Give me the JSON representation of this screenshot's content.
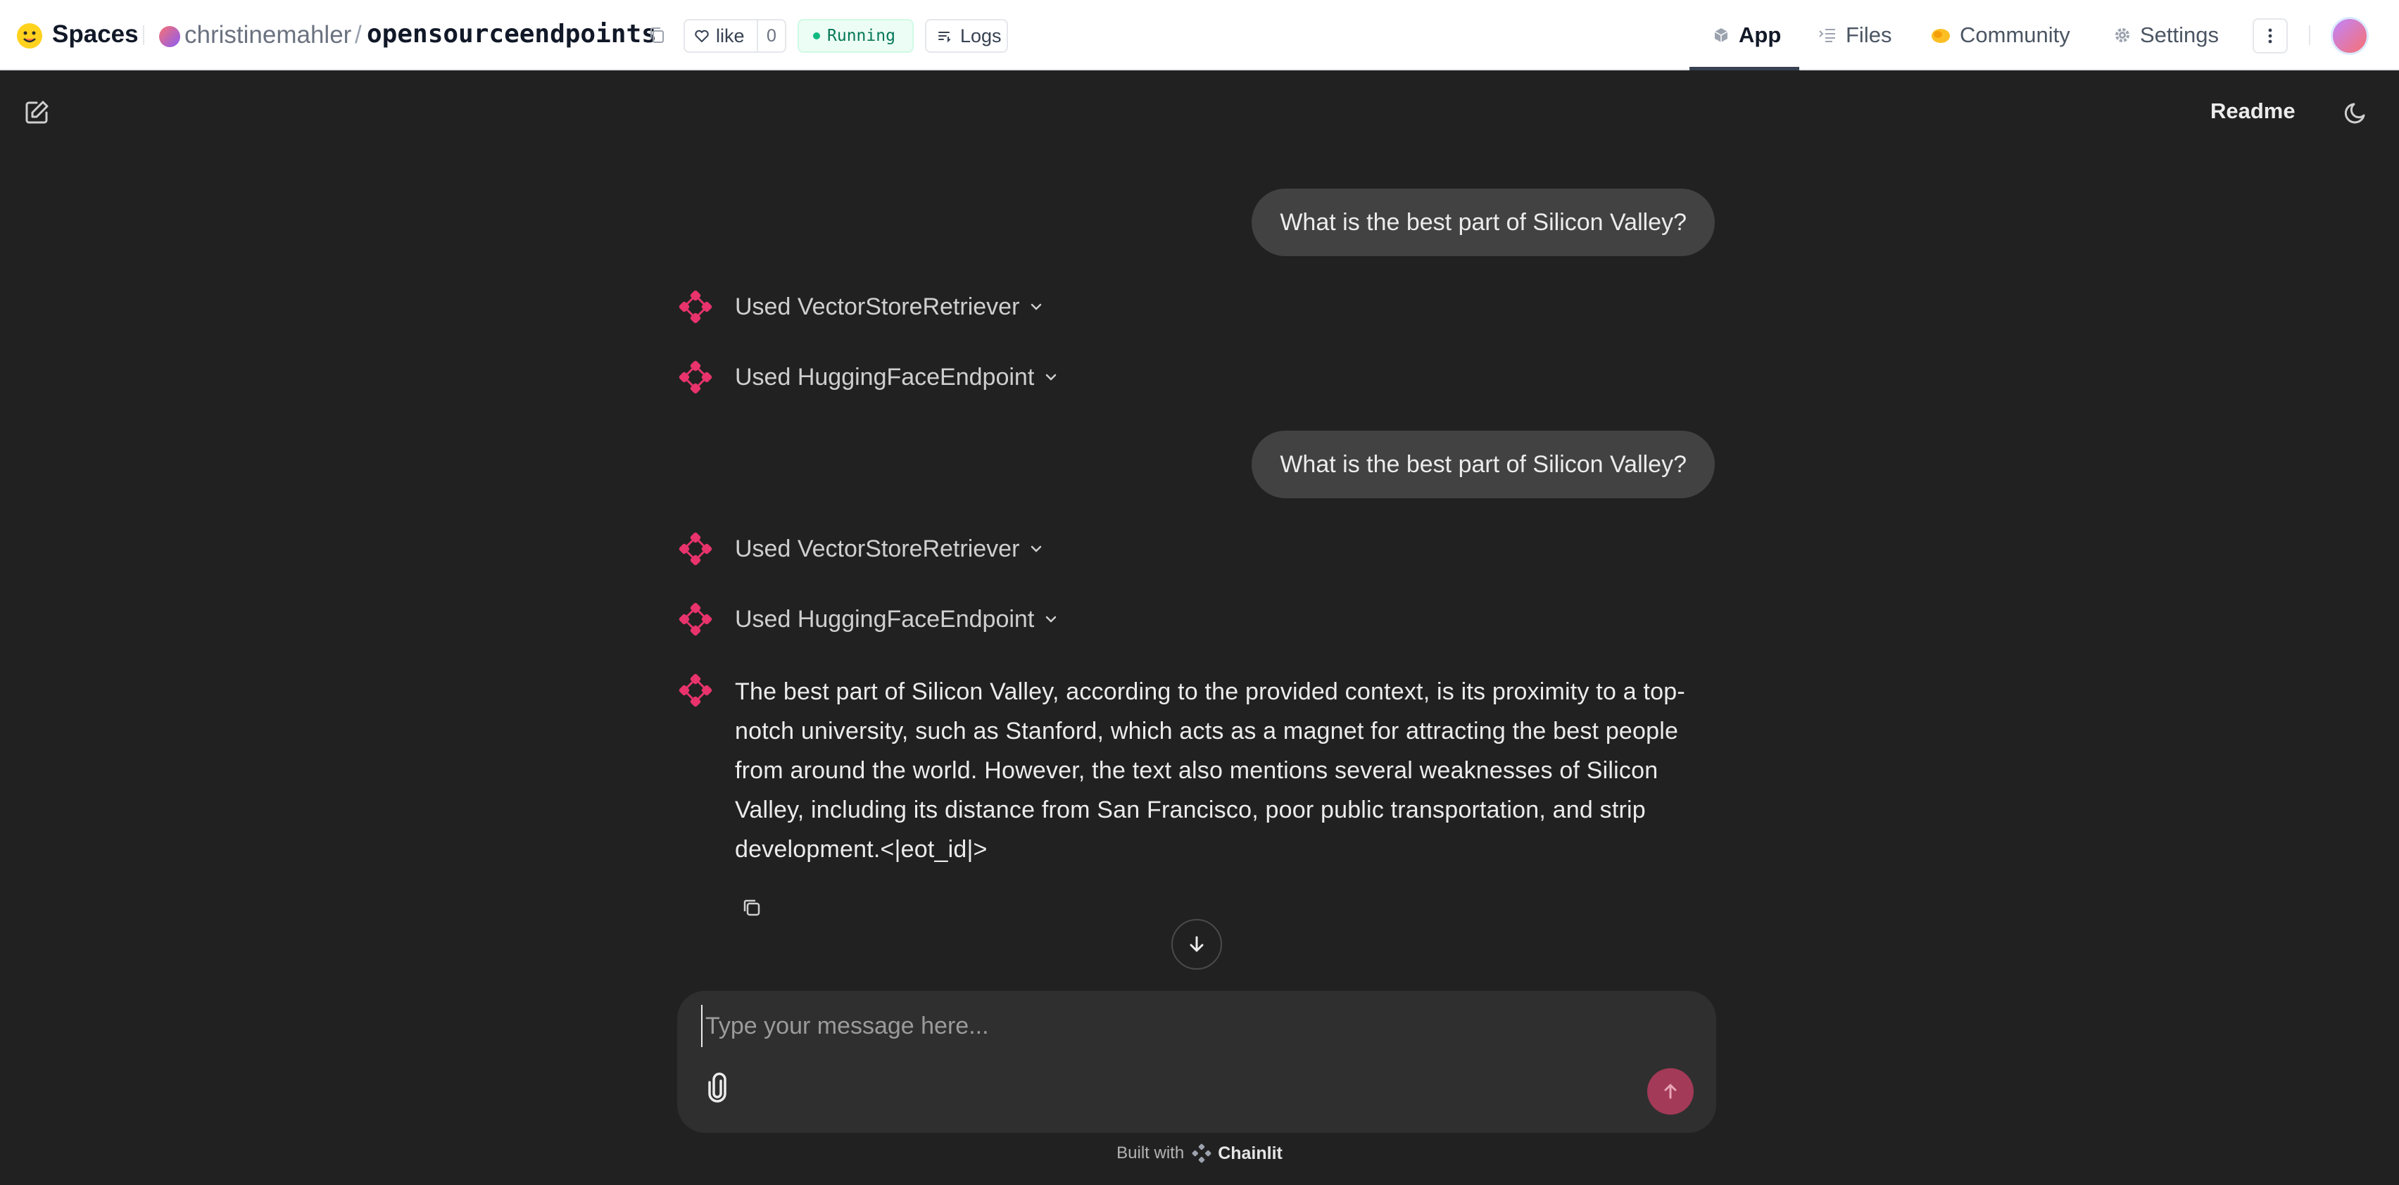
{
  "header": {
    "spaces_label": "Spaces",
    "owner": "christinemahler",
    "separator": "/",
    "repo": "opensourceendpoints",
    "like_label": "like",
    "like_count": "0",
    "status": "Running",
    "logs_label": "Logs",
    "tabs": [
      {
        "label": "App",
        "icon": "cube-icon",
        "active": true
      },
      {
        "label": "Files",
        "icon": "files-icon",
        "active": false
      },
      {
        "label": "Community",
        "icon": "community-icon",
        "active": false
      },
      {
        "label": "Settings",
        "icon": "gear-icon",
        "active": false
      }
    ]
  },
  "app": {
    "readme_label": "Readme",
    "messages": [
      {
        "type": "user",
        "text": "What is the best part of Silicon Valley?"
      },
      {
        "type": "step",
        "text": "Used VectorStoreRetriever"
      },
      {
        "type": "step",
        "text": "Used HuggingFaceEndpoint"
      },
      {
        "type": "user",
        "text": "What is the best part of Silicon Valley?"
      },
      {
        "type": "step",
        "text": "Used VectorStoreRetriever"
      },
      {
        "type": "step",
        "text": "Used HuggingFaceEndpoint"
      },
      {
        "type": "assistant",
        "text": "The best part of Silicon Valley, according to the provided context, is its proximity to a top-notch university, such as Stanford, which acts as a magnet for attracting the best people from around the world. However, the text also mentions several weaknesses of Silicon Valley, including its distance from San Francisco, poor public transportation, and strip development.<|eot_id|>"
      }
    ],
    "composer": {
      "placeholder": "Type your message here..."
    },
    "footer": {
      "built_with": "Built with",
      "brand": "Chainlit"
    }
  },
  "colors": {
    "accent": "#e8336c",
    "send_button": "#a33a57",
    "background": "#212121",
    "bubble": "#424242",
    "running_green": "#10b981"
  }
}
